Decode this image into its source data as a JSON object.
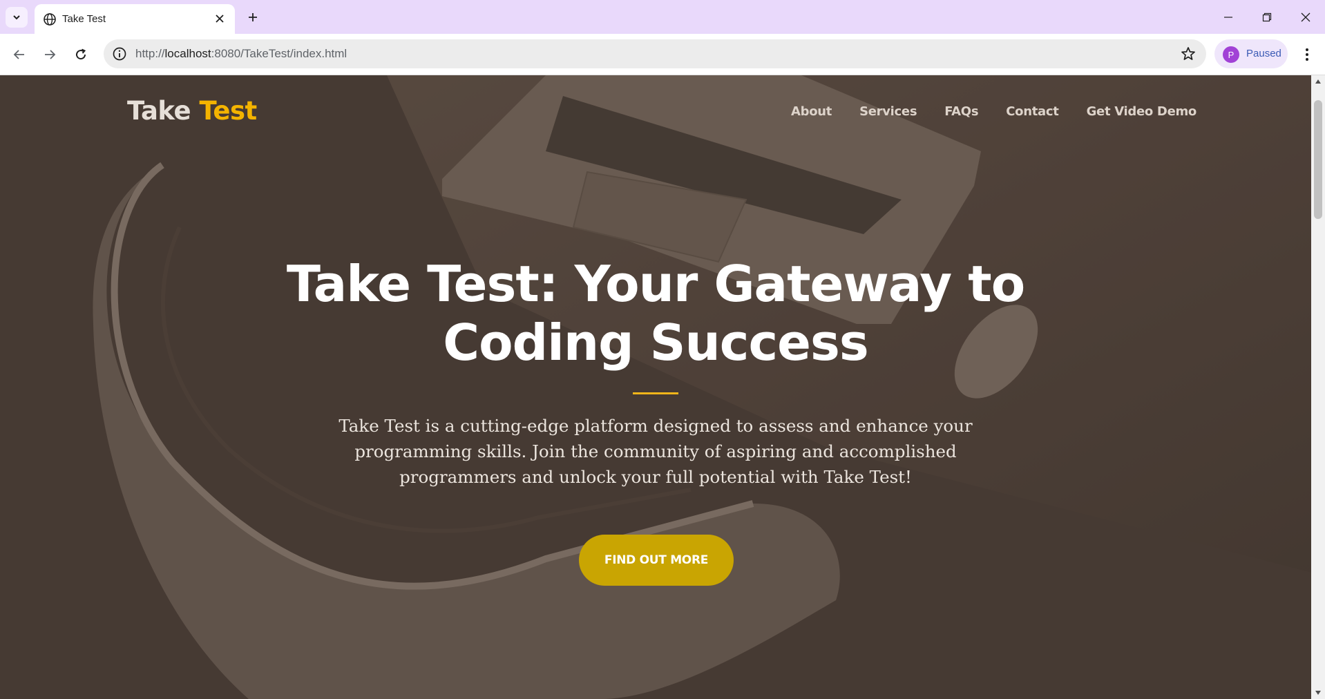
{
  "browser": {
    "tab_title": "Take Test",
    "url_scheme": "http://",
    "url_host": "localhost",
    "url_rest": ":8080/TakeTest/index.html",
    "profile_initial": "P",
    "profile_status": "Paused",
    "accent_color": "#e9d9fb"
  },
  "site": {
    "brand_part1": "Take",
    "brand_part2": "Test",
    "brand_accent_color": "#f4b400",
    "nav": {
      "about": "About",
      "services": "Services",
      "faqs": "FAQs",
      "contact": "Contact",
      "demo": "Get Video Demo"
    }
  },
  "hero": {
    "title": "Take Test: Your Gateway to Coding Success",
    "description": "Take Test is a cutting-edge platform designed to assess and enhance your programming skills. Join the community of aspiring and accomplished programmers and unlock your full potential with Take Test!",
    "cta_label": "FIND OUT MORE",
    "cta_color": "#c9a502",
    "background_image": "laptop-mouse-chair-desk-photo"
  },
  "icons": {
    "tab_search": "chevron-down-icon",
    "favicon": "globe-icon",
    "close": "close-icon",
    "new_tab": "plus-icon",
    "back": "arrow-left-icon",
    "forward": "arrow-right-icon",
    "reload": "reload-icon",
    "site_info": "info-icon",
    "bookmark": "star-icon",
    "menu": "kebab-menu-icon"
  }
}
